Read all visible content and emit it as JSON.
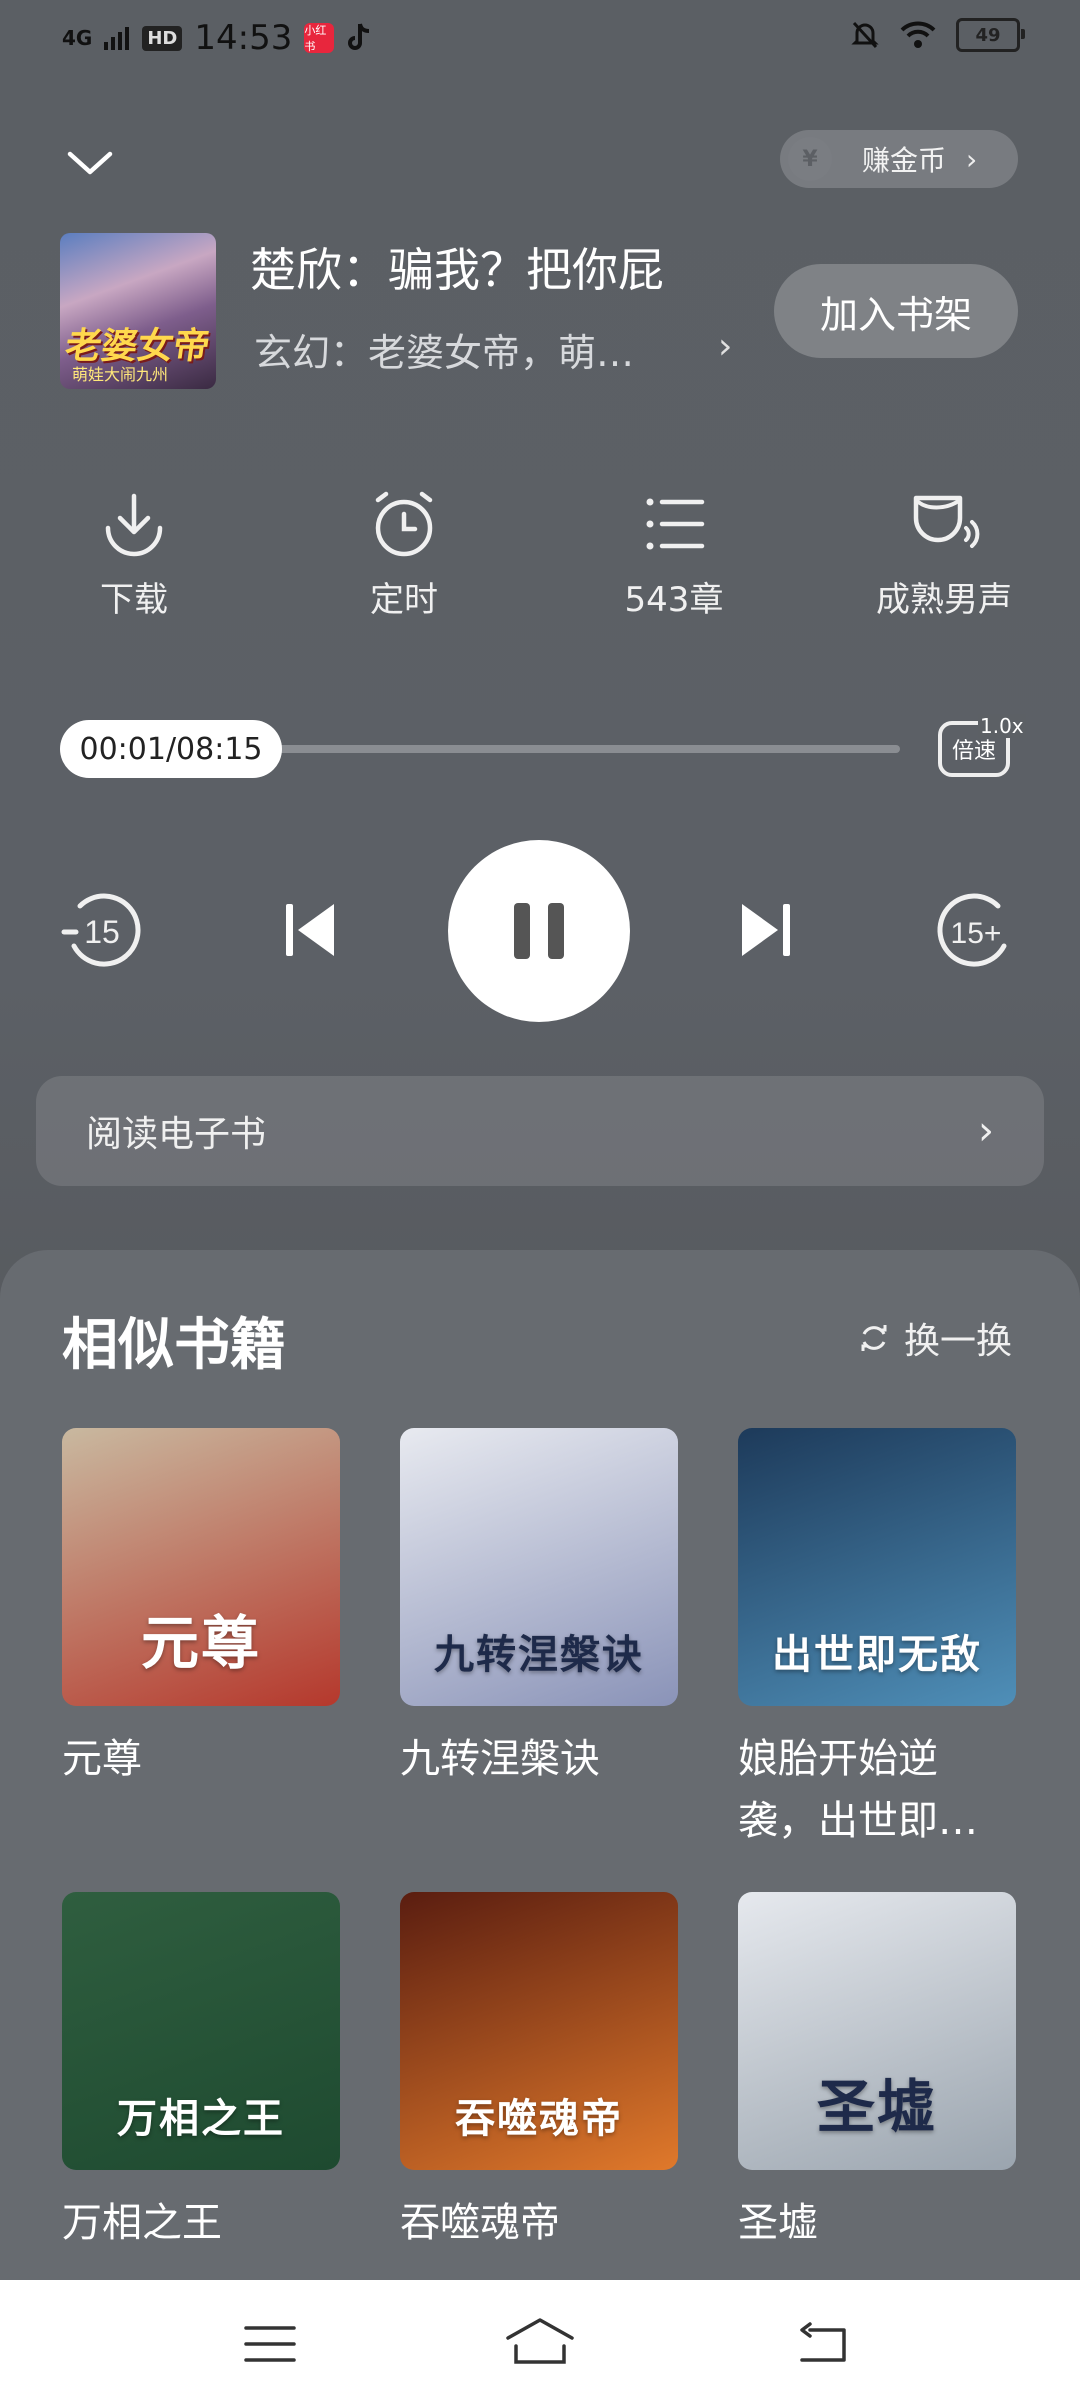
{
  "status_bar": {
    "network": "4G",
    "hd": "HD",
    "time": "14:53",
    "app_badge": "小红书",
    "battery": "49"
  },
  "header": {
    "earn_label": "赚金币"
  },
  "book": {
    "cover_title": "老婆女帝",
    "cover_subtitle": "萌娃大闹九州",
    "title": "楚欣：骗我？把你屁",
    "subtitle": "玄幻：老婆女帝，萌…",
    "add_shelf": "加入书架"
  },
  "actions": [
    {
      "label": "下载",
      "icon": "download-icon"
    },
    {
      "label": "定时",
      "icon": "alarm-icon"
    },
    {
      "label": "543章",
      "icon": "chapter-list-icon"
    },
    {
      "label": "成熟男声",
      "icon": "voice-icon"
    }
  ],
  "player": {
    "time": "00:01/08:15",
    "progress": 0.002,
    "speed_label": "倍速",
    "speed_value": "1.0x",
    "rewind": "15",
    "forward": "15+"
  },
  "ebook": {
    "label": "阅读电子书"
  },
  "similar": {
    "title": "相似书籍",
    "refresh": "换一换",
    "books": [
      {
        "name": "元尊",
        "cover_text": "元尊",
        "colors": [
          "#c9b9a0",
          "#b5382c"
        ]
      },
      {
        "name": "九转涅槃诀",
        "cover_text": "九转涅槃诀",
        "colors": [
          "#e8eaf0",
          "#8a93b8"
        ]
      },
      {
        "name": "娘胎开始逆袭，出世即…",
        "cover_text": "出世即无敌",
        "colors": [
          "#1d3a5a",
          "#4f8fb8"
        ]
      },
      {
        "name": "万相之王",
        "cover_text": "万相之王",
        "colors": [
          "#2f5e3f",
          "#1e4a30"
        ]
      },
      {
        "name": "吞噬魂帝",
        "cover_text": "吞噬魂帝",
        "colors": [
          "#5a1d10",
          "#e0792b"
        ]
      },
      {
        "name": "圣墟",
        "cover_text": "圣墟",
        "colors": [
          "#e6e9ee",
          "#9aa4ae"
        ]
      }
    ]
  }
}
